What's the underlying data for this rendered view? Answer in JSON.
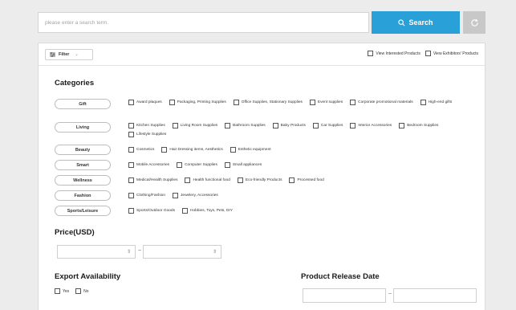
{
  "search": {
    "placeholder": "please enter a search term.",
    "button_label": "Search"
  },
  "filter": {
    "label": "Filter",
    "view_options": [
      "View Interested Products",
      "View Exhibitors' Products"
    ]
  },
  "categories": {
    "title": "Categories",
    "groups": [
      {
        "name": "Gift",
        "items": [
          "Award plaques",
          "Packaging, Printing Supplies",
          "Office Supplies, Stationary Supplies",
          "Event supplies",
          "Corporate promotional materials",
          "High-end gifts"
        ]
      },
      {
        "name": "Living",
        "items": [
          "Kitchen Supplies",
          "Living Room Supplies",
          "Bathroom Supplies",
          "Baby Products",
          "Car Supplies",
          "Interior Accessories",
          "Bedroom Supplies",
          "Lifestyle Supplies"
        ]
      },
      {
        "name": "Beauty",
        "items": [
          "Cosmetics",
          "Hair Dressing items, Aesthetics",
          "Esthetic equipment"
        ]
      },
      {
        "name": "Smart",
        "items": [
          "Mobile Accessories",
          "Computer Supplies",
          "Small appliances"
        ]
      },
      {
        "name": "Wellness",
        "items": [
          "Medical/Health Supplies",
          "Health functional food",
          "Eco-friendly Products",
          "Processed food"
        ]
      },
      {
        "name": "Fashion",
        "items": [
          "Clothing/Fashion",
          "Jewelery, Accessories"
        ]
      },
      {
        "name": "Sports/Leisure",
        "items": [
          "Sports/Outdoor Goods",
          "Hobbies, Toys, Pets, DIY"
        ]
      }
    ]
  },
  "price": {
    "title": "Price(USD)",
    "separator": "~"
  },
  "export": {
    "title": "Export Availability",
    "options": [
      "Yes",
      "No"
    ]
  },
  "release": {
    "title": "Product Release Date",
    "separator": "~"
  },
  "icons": {
    "search": "search-icon",
    "refresh": "refresh-icon",
    "filter": "filter-icon",
    "chevron": "chevron-down-icon"
  },
  "colors": {
    "accent": "#2aa0d9",
    "refresh_bg": "#c8c8c8"
  }
}
